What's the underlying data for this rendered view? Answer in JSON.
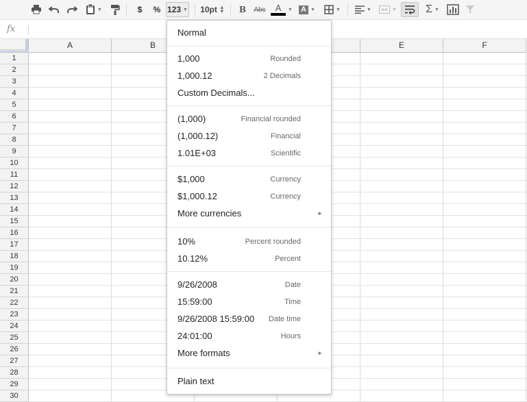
{
  "toolbar": {
    "currency_label": "$",
    "percent_label": "%",
    "number_format_label": "123",
    "font_size_label": "10pt",
    "bold_label": "B",
    "strike_label": "Abc",
    "text_color_label": "A",
    "fill_color_label": "A",
    "functions_label": "Σ"
  },
  "formula_bar": {
    "fx_label": "fx"
  },
  "grid": {
    "columns": [
      "A",
      "B",
      "",
      "",
      "E",
      "F"
    ],
    "rows": [
      "1",
      "2",
      "3",
      "4",
      "5",
      "6",
      "7",
      "8",
      "9",
      "10",
      "11",
      "12",
      "13",
      "14",
      "15",
      "16",
      "17",
      "18",
      "19",
      "20",
      "21",
      "22",
      "23",
      "24",
      "25",
      "26",
      "27",
      "28",
      "29",
      "30"
    ]
  },
  "menu": {
    "items": [
      {
        "label": "Normal",
        "desc": ""
      },
      {
        "label": "1,000",
        "desc": "Rounded"
      },
      {
        "label": "1,000.12",
        "desc": "2 Decimals"
      },
      {
        "label": "Custom Decimals...",
        "desc": ""
      },
      {
        "label": "(1,000)",
        "desc": "Financial rounded"
      },
      {
        "label": "(1,000.12)",
        "desc": "Financial"
      },
      {
        "label": "1.01E+03",
        "desc": "Scientific"
      },
      {
        "label": "$1,000",
        "desc": "Currency"
      },
      {
        "label": "$1,000.12",
        "desc": "Currency"
      },
      {
        "label": "More currencies",
        "desc": "",
        "submenu": "►"
      },
      {
        "label": "10%",
        "desc": "Percent rounded"
      },
      {
        "label": "10.12%",
        "desc": "Percent"
      },
      {
        "label": "9/26/2008",
        "desc": "Date"
      },
      {
        "label": "15:59:00",
        "desc": "Time"
      },
      {
        "label": "9/26/2008 15:59:00",
        "desc": "Date time"
      },
      {
        "label": "24:01:00",
        "desc": "Hours"
      },
      {
        "label": "More formats",
        "desc": "",
        "submenu": "►"
      },
      {
        "label": "Plain text",
        "desc": ""
      }
    ]
  },
  "colors": {
    "accent_selection": "#c7cde2",
    "text_color_bar": "#000000"
  }
}
